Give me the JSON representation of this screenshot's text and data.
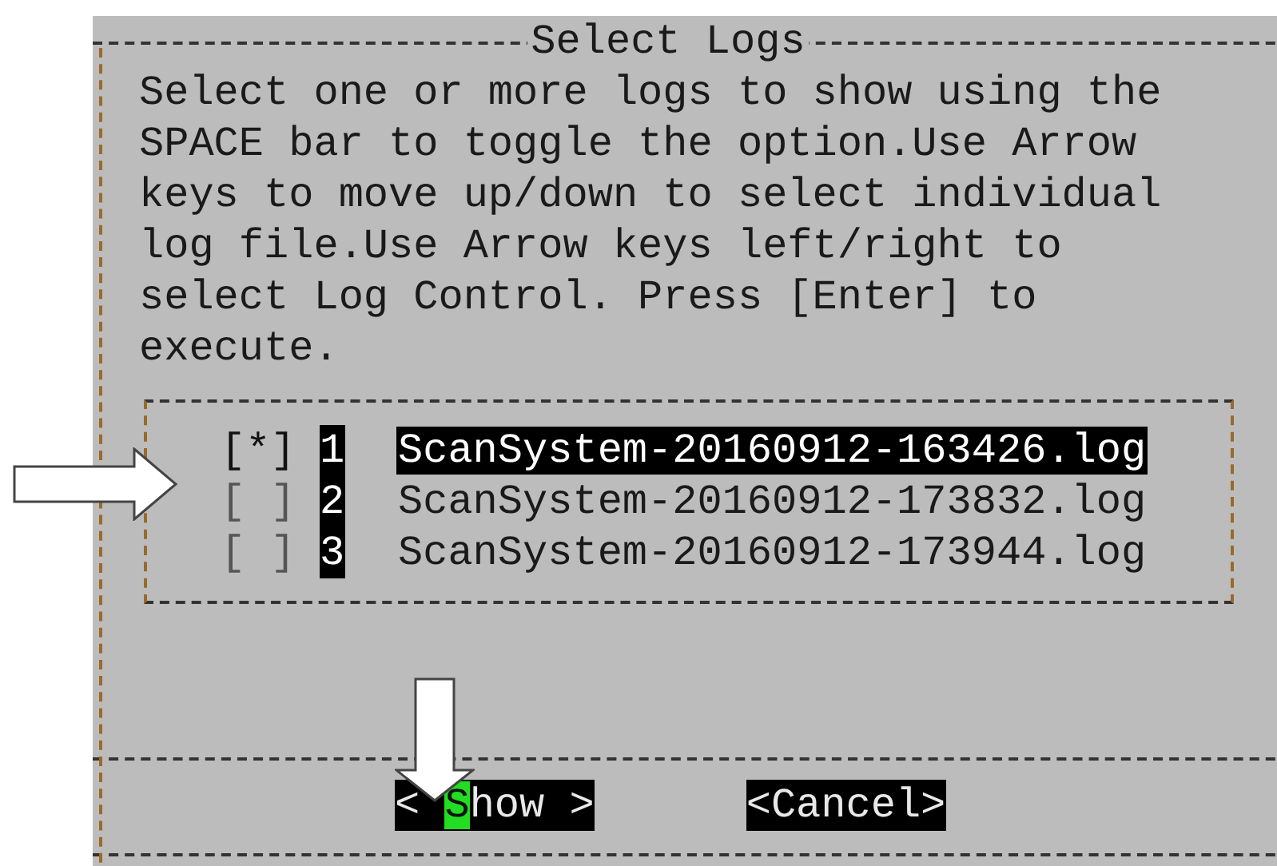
{
  "dialog": {
    "title": "Select Logs",
    "instructions": [
      "Select one or more logs to show using the",
      "SPACE bar to toggle the option.Use Arrow",
      "keys to move up/down to select individual",
      "log file.Use Arrow keys left/right to",
      "select Log Control. Press [Enter] to",
      "execute."
    ],
    "logs": [
      {
        "checkbox": "[*]",
        "checked": true,
        "number": "1",
        "file": "ScanSystem-20160912-163426.log",
        "selected": true
      },
      {
        "checkbox": "[ ]",
        "checked": false,
        "number": "2",
        "file": "ScanSystem-20160912-173832.log",
        "selected": false
      },
      {
        "checkbox": "[ ]",
        "checked": false,
        "number": "3",
        "file": "ScanSystem-20160912-173944.log",
        "selected": false
      }
    ],
    "buttons": [
      {
        "before": "< ",
        "hotkey": "S",
        "after": "how >"
      },
      {
        "before": "<Cancel>"
      }
    ]
  },
  "annotations": [
    {
      "kind": "arrow-right"
    },
    {
      "kind": "arrow-down"
    }
  ]
}
